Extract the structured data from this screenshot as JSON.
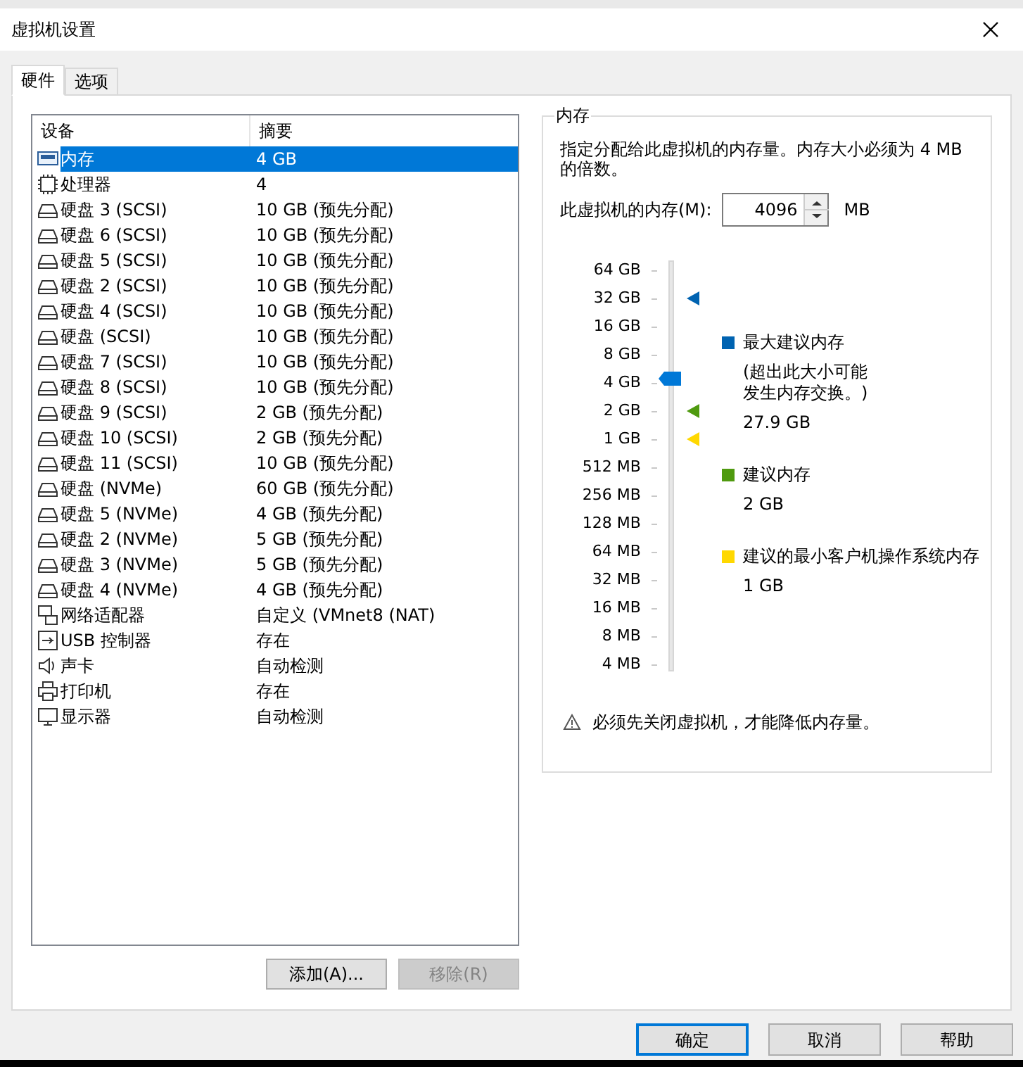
{
  "window": {
    "title": "虚拟机设置"
  },
  "tabs": [
    {
      "label": "硬件",
      "selected": true
    },
    {
      "label": "选项",
      "selected": false
    }
  ],
  "device_table": {
    "columns": [
      "设备",
      "摘要"
    ],
    "rows": [
      {
        "kind": "memory",
        "device": "内存",
        "summary": "4 GB",
        "selected": true
      },
      {
        "kind": "cpu",
        "device": "处理器",
        "summary": "4",
        "selected": false
      },
      {
        "kind": "disk",
        "device": "硬盘 3 (SCSI)",
        "summary": "10 GB (预先分配)",
        "selected": false
      },
      {
        "kind": "disk",
        "device": "硬盘 6 (SCSI)",
        "summary": "10 GB (预先分配)",
        "selected": false
      },
      {
        "kind": "disk",
        "device": "硬盘 5 (SCSI)",
        "summary": "10 GB (预先分配)",
        "selected": false
      },
      {
        "kind": "disk",
        "device": "硬盘 2 (SCSI)",
        "summary": "10 GB (预先分配)",
        "selected": false
      },
      {
        "kind": "disk",
        "device": "硬盘 4 (SCSI)",
        "summary": "10 GB (预先分配)",
        "selected": false
      },
      {
        "kind": "disk",
        "device": "硬盘 (SCSI)",
        "summary": "10 GB (预先分配)",
        "selected": false
      },
      {
        "kind": "disk",
        "device": "硬盘 7 (SCSI)",
        "summary": "10 GB (预先分配)",
        "selected": false
      },
      {
        "kind": "disk",
        "device": "硬盘 8 (SCSI)",
        "summary": "10 GB (预先分配)",
        "selected": false
      },
      {
        "kind": "disk",
        "device": "硬盘 9 (SCSI)",
        "summary": "2 GB (预先分配)",
        "selected": false
      },
      {
        "kind": "disk",
        "device": "硬盘 10 (SCSI)",
        "summary": "2 GB (预先分配)",
        "selected": false
      },
      {
        "kind": "disk",
        "device": "硬盘 11 (SCSI)",
        "summary": "10 GB (预先分配)",
        "selected": false
      },
      {
        "kind": "disk",
        "device": "硬盘 (NVMe)",
        "summary": "60 GB (预先分配)",
        "selected": false
      },
      {
        "kind": "disk",
        "device": "硬盘 5 (NVMe)",
        "summary": "4 GB (预先分配)",
        "selected": false
      },
      {
        "kind": "disk",
        "device": "硬盘 2 (NVMe)",
        "summary": "5 GB (预先分配)",
        "selected": false
      },
      {
        "kind": "disk",
        "device": "硬盘 3 (NVMe)",
        "summary": "5 GB (预先分配)",
        "selected": false
      },
      {
        "kind": "disk",
        "device": "硬盘 4 (NVMe)",
        "summary": "4 GB (预先分配)",
        "selected": false
      },
      {
        "kind": "network",
        "device": "网络适配器",
        "summary": "自定义 (VMnet8 (NAT)",
        "selected": false
      },
      {
        "kind": "usb",
        "device": "USB 控制器",
        "summary": "存在",
        "selected": false
      },
      {
        "kind": "sound",
        "device": "声卡",
        "summary": "自动检测",
        "selected": false
      },
      {
        "kind": "printer",
        "device": "打印机",
        "summary": "存在",
        "selected": false
      },
      {
        "kind": "display",
        "device": "显示器",
        "summary": "自动检测",
        "selected": false
      }
    ]
  },
  "list_buttons": [
    {
      "label": "添加(A)...",
      "disabled": false
    },
    {
      "label": "移除(R)",
      "disabled": true
    }
  ],
  "memory_panel": {
    "title": "内存",
    "description": "指定分配给此虚拟机的内存量。内存大小必须为 4 MB 的倍数。",
    "field_label": "此虚拟机的内存(M):",
    "value": "4096",
    "unit": "MB",
    "scale_labels": [
      "64 GB",
      "32 GB",
      "16 GB",
      "8 GB",
      "4 GB",
      "2 GB",
      "1 GB",
      "512 MB",
      "256 MB",
      "128 MB",
      "64 MB",
      "32 MB",
      "16 MB",
      "8 MB",
      "4 MB"
    ],
    "slider": {
      "level": 0.714
    },
    "markers": [
      {
        "color": "#0063b1",
        "label": "最大建议内存",
        "note": "(超出此大小可能发生内存交换。)",
        "value": "27.9 GB"
      },
      {
        "color": "#4f9a0f",
        "label": "建议内存",
        "value": "2 GB"
      },
      {
        "color": "#ffd800",
        "label": "建议的最小客户机操作系统内存",
        "value": "1 GB"
      }
    ],
    "warning": "必须先关闭虚拟机，才能降低内存量。"
  },
  "dialog_buttons": [
    {
      "label": "确定",
      "default": true
    },
    {
      "label": "取消",
      "default": false
    },
    {
      "label": "帮助",
      "default": false
    }
  ]
}
